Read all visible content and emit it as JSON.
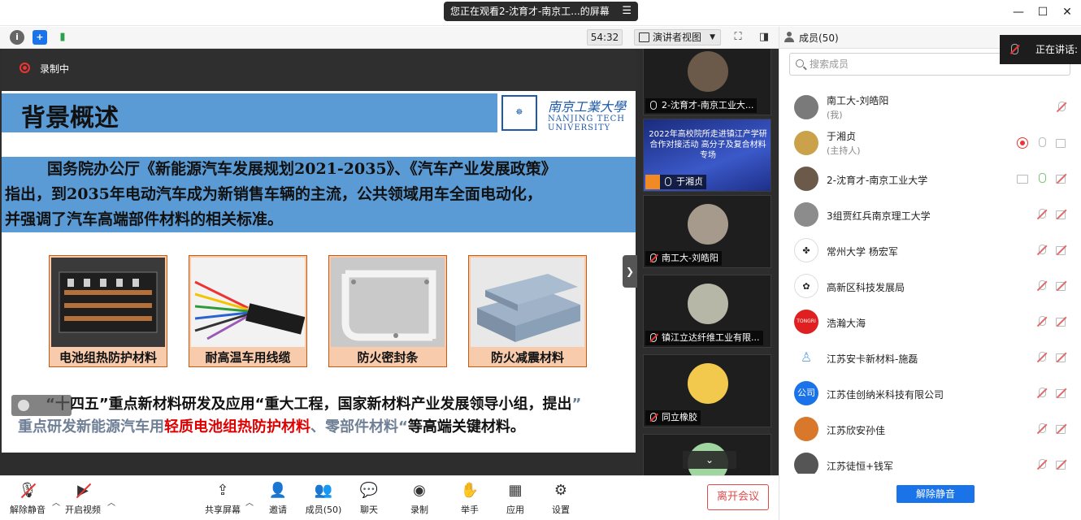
{
  "titlebar": {
    "watching_text": "您正在观看2-沈育才-南京工...的屏幕",
    "menu_glyph": "☰"
  },
  "toolbar": {
    "timer": "54:32",
    "view_label": "演讲者视图"
  },
  "recording": {
    "label": "录制中"
  },
  "slide": {
    "title": "背景概述",
    "logo_cn": "南京工業大學",
    "logo_en_1": "NANJING TECH",
    "logo_en_2": "UNIVERSITY",
    "paragraph_line1": "国务院办公厅《新能源汽车发展规划2021-2035》、《汽车产业发展政策》",
    "paragraph_line2": "指出，到2035年电动汽车成为新销售车辆的主流，公共领域用车全面电动化，",
    "paragraph_line3": "并强调了汽车高端部件材料的相关标准。",
    "tiles": [
      {
        "caption": "电池组热防护材料"
      },
      {
        "caption": "耐高温车用线缆"
      },
      {
        "caption": "防火密封条"
      },
      {
        "caption": "防火减震材料"
      }
    ],
    "bottom_line1_a": "“十四五”",
    "bottom_line1_b": "重点新材料研发及应用“重大工程，国家新材料产业发展领导小组，提出",
    "bottom_line1_c": "”",
    "bottom_line2_a": "重点研发新能源汽车用",
    "bottom_line2_b": "轻质电池组热防护材料",
    "bottom_line2_c": "、零部件材料",
    "bottom_line2_d": "“",
    "bottom_line2_e": "等高端关键材料。"
  },
  "videos": [
    {
      "label": "2-沈育才-南京工业大..."
    },
    {
      "label": "于湘贞",
      "banner_text": "2022年高校院所走进镇江产学研合作对接活动 高分子及复合材料专场"
    },
    {
      "label": "南工大-刘皓阳"
    },
    {
      "label": "镇江立达纤维工业有限..."
    },
    {
      "label": "同立橡胶"
    }
  ],
  "members_panel": {
    "title": "成员(50)",
    "speaking_label": "正在讲话:",
    "search_placeholder": "搜索成员",
    "unmute_all": "解除静音",
    "members": [
      {
        "name": "南工大-刘皓阳",
        "role": "(我)"
      },
      {
        "name": "于湘贞",
        "role": "(主持人)"
      },
      {
        "name": "2-沈育才-南京工业大学"
      },
      {
        "name": "3组贾红兵南京理工大学"
      },
      {
        "name": "常州大学 杨宏军"
      },
      {
        "name": "高新区科技发展局"
      },
      {
        "name": "浩瀚大海",
        "avatar_text": "TONGRI"
      },
      {
        "name": "江苏安卡新材料-施磊"
      },
      {
        "name": "江苏佳创纳米科技有限公司",
        "avatar_text": "公司"
      },
      {
        "name": "江苏欣安孙佳"
      },
      {
        "name": "江苏徒恒+钱军"
      }
    ]
  },
  "bottombar": {
    "unmute": "解除静音",
    "start_video": "开启视频",
    "share_screen": "共享屏幕",
    "invite": "邀请",
    "members": "成员(50)",
    "chat": "聊天",
    "record": "录制",
    "raise_hand": "举手",
    "apps": "应用",
    "settings": "设置",
    "leave": "离开会议"
  },
  "colors": {
    "slide_band": "#5b9bd5",
    "tile_caption_bg": "#f8cbad",
    "accent_blue": "#1a73e8",
    "leave_red": "#e04a4a"
  }
}
